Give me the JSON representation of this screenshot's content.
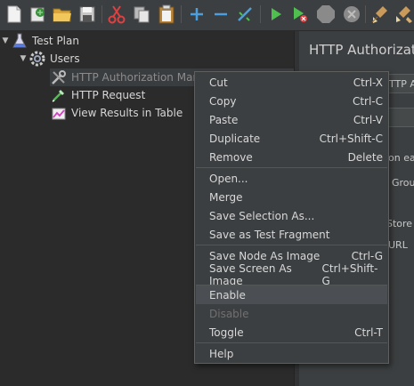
{
  "toolbar": {
    "icons": [
      "new-icon",
      "templates-icon",
      "open-icon",
      "save-icon",
      "cut-icon",
      "copy-icon",
      "paste-icon",
      "expand-icon",
      "collapse-icon",
      "toggle-icon",
      "start-icon",
      "start-no-pauses-icon",
      "stop-icon",
      "shutdown-icon",
      "clear-icon",
      "clear-all-icon"
    ],
    "colors": {
      "green": "#4fc04f",
      "blue": "#4a9fe0",
      "red": "#e04040"
    }
  },
  "tree": {
    "items": [
      {
        "label": "Test Plan",
        "icon": "flask-icon",
        "expanded": true
      },
      {
        "label": "Users",
        "icon": "gear-icon",
        "expanded": true
      },
      {
        "label": "HTTP Authorization Mana",
        "icon": "wrench-icon",
        "disabled": true
      },
      {
        "label": "HTTP Request",
        "icon": "pipette-icon"
      },
      {
        "label": "View Results in Table",
        "icon": "results-icon"
      }
    ]
  },
  "right_pane": {
    "title": "HTTP Authorizatio",
    "fragments": [
      "TTP A",
      "on ea",
      "Grou",
      "Store",
      "URL"
    ]
  },
  "context_menu": {
    "items": [
      {
        "label": "Cut",
        "shortcut": "Ctrl-X"
      },
      {
        "label": "Copy",
        "shortcut": "Ctrl-C"
      },
      {
        "label": "Paste",
        "shortcut": "Ctrl-V"
      },
      {
        "label": "Duplicate",
        "shortcut": "Ctrl+Shift-C"
      },
      {
        "label": "Remove",
        "shortcut": "Delete"
      },
      {
        "label": "Open..."
      },
      {
        "label": "Merge"
      },
      {
        "label": "Save Selection As..."
      },
      {
        "label": "Save as Test Fragment"
      },
      {
        "label": "Save Node As Image",
        "shortcut": "Ctrl-G"
      },
      {
        "label": "Save Screen As Image",
        "shortcut": "Ctrl+Shift-G"
      },
      {
        "label": "Enable",
        "highlighted": true
      },
      {
        "label": "Disable",
        "disabled": true
      },
      {
        "label": "Toggle",
        "shortcut": "Ctrl-T"
      },
      {
        "label": "Help"
      }
    ]
  }
}
